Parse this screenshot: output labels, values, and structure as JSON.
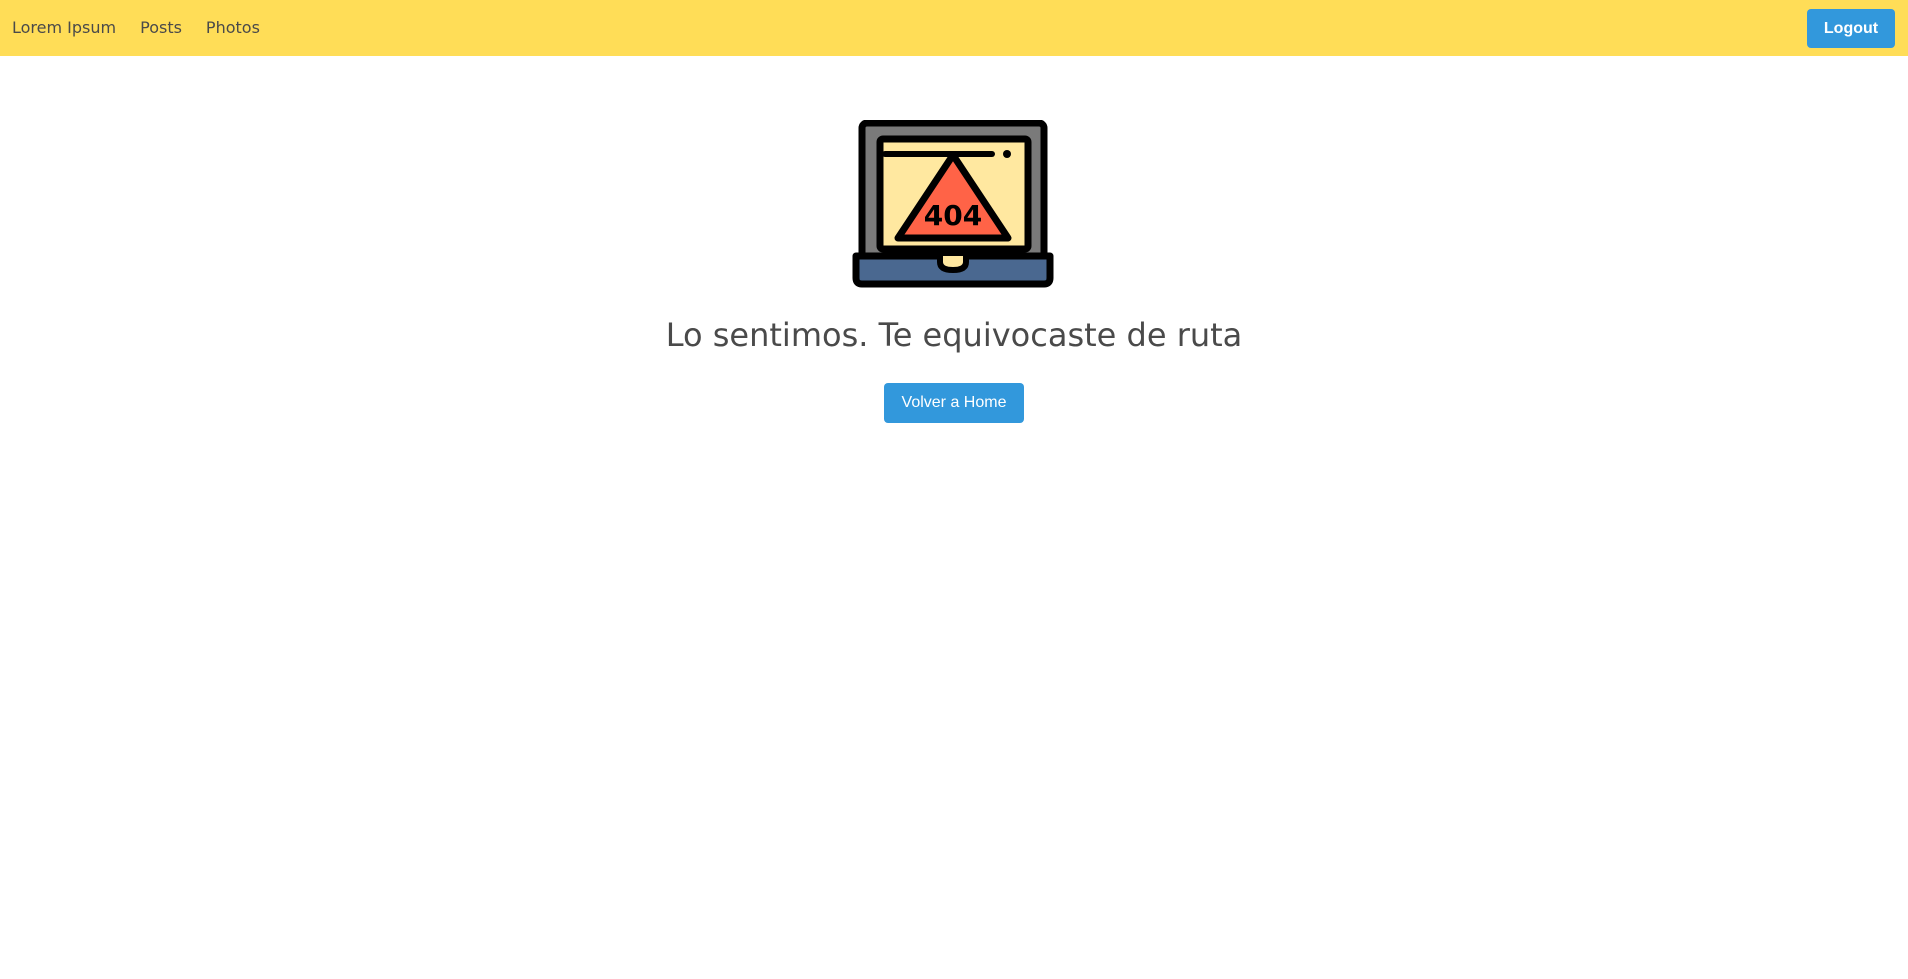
{
  "navbar": {
    "background": "#ffdd57",
    "links": [
      {
        "label": "Lorem Ipsum"
      },
      {
        "label": "Posts"
      },
      {
        "label": "Photos"
      }
    ],
    "logout_label": "Logout"
  },
  "error": {
    "icon": "laptop-404-icon",
    "icon_text": "404",
    "message": "Lo sentimos. Te equivocaste de ruta",
    "home_button_label": "Volver a Home"
  },
  "colors": {
    "accent": "#3298dc",
    "navbar": "#ffdd57",
    "text": "#4a4a4a"
  }
}
